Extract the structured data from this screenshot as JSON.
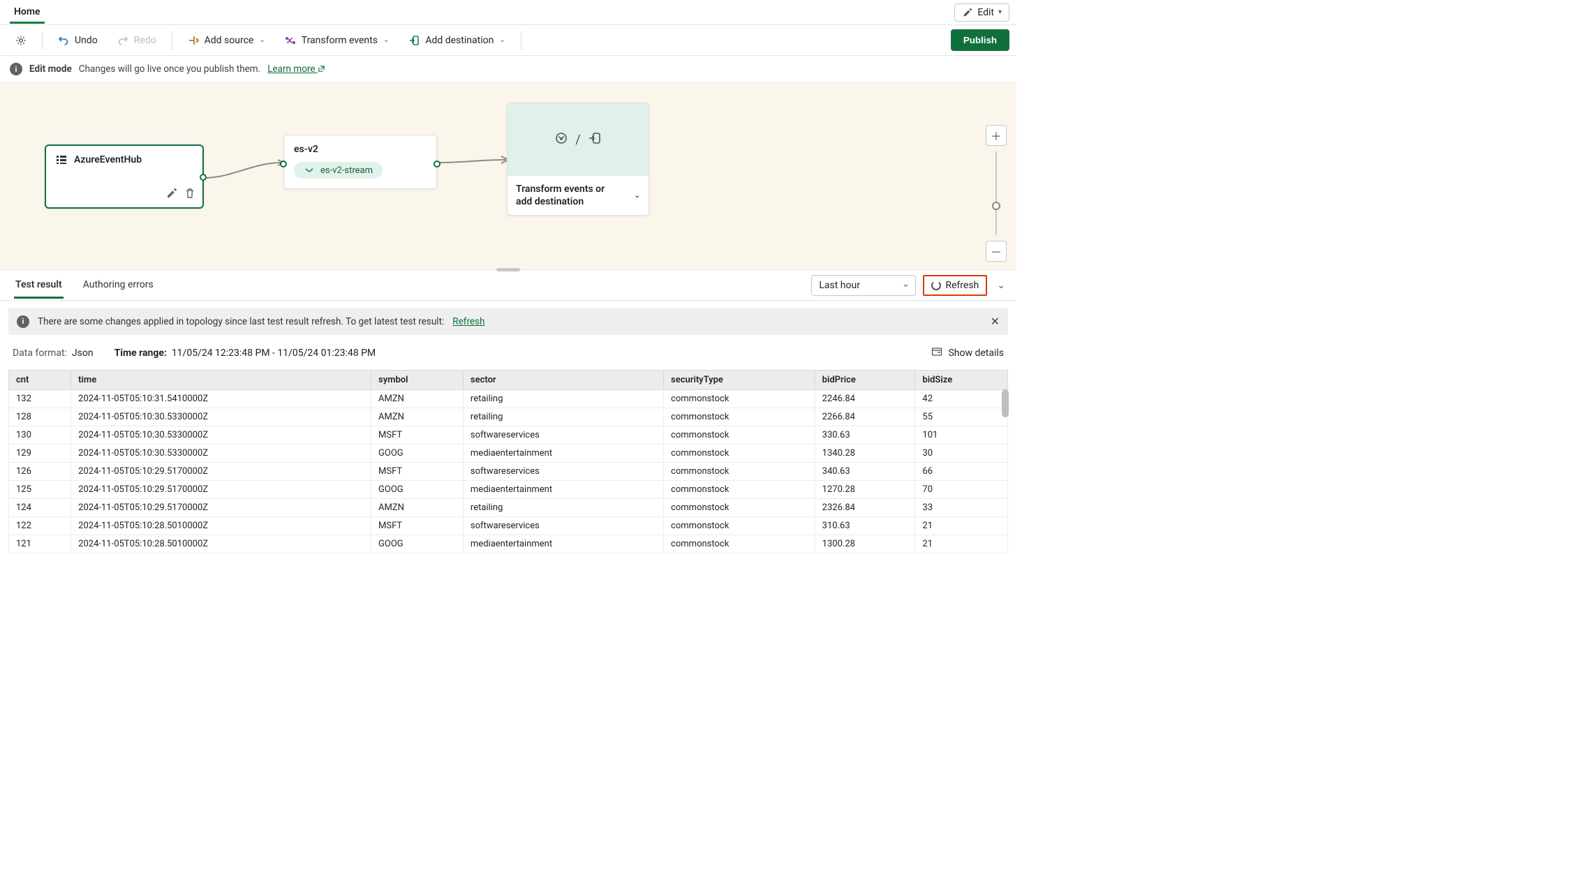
{
  "header": {
    "home": "Home",
    "edit": "Edit"
  },
  "toolbar": {
    "undo": "Undo",
    "redo": "Redo",
    "addSource": "Add source",
    "transform": "Transform events",
    "addDest": "Add destination",
    "publish": "Publish"
  },
  "editBanner": {
    "title": "Edit mode",
    "msg": "Changes will go live once you publish them.",
    "learn": "Learn more"
  },
  "canvas": {
    "source": "AzureEventHub",
    "stream": {
      "name": "es-v2",
      "chip": "es-v2-stream"
    },
    "target": {
      "title": "Transform events or add destination",
      "sep": "/"
    }
  },
  "results": {
    "tabs": {
      "test": "Test result",
      "errors": "Authoring errors"
    },
    "timeRange": "Last hour",
    "refresh": "Refresh",
    "warn": "There are some changes applied in topology since last test result refresh. To get latest test result:",
    "warnLink": "Refresh",
    "dataFormatLabel": "Data format:",
    "dataFormat": "Json",
    "timeRangeLabel": "Time range:",
    "timeRangeVal": "11/05/24 12:23:48 PM - 11/05/24 01:23:48 PM",
    "showDetails": "Show details",
    "columns": [
      "cnt",
      "time",
      "symbol",
      "sector",
      "securityType",
      "bidPrice",
      "bidSize"
    ],
    "rows": [
      [
        "132",
        "2024-11-05T05:10:31.5410000Z",
        "AMZN",
        "retailing",
        "commonstock",
        "2246.84",
        "42"
      ],
      [
        "128",
        "2024-11-05T05:10:30.5330000Z",
        "AMZN",
        "retailing",
        "commonstock",
        "2266.84",
        "55"
      ],
      [
        "130",
        "2024-11-05T05:10:30.5330000Z",
        "MSFT",
        "softwareservices",
        "commonstock",
        "330.63",
        "101"
      ],
      [
        "129",
        "2024-11-05T05:10:30.5330000Z",
        "GOOG",
        "mediaentertainment",
        "commonstock",
        "1340.28",
        "30"
      ],
      [
        "126",
        "2024-11-05T05:10:29.5170000Z",
        "MSFT",
        "softwareservices",
        "commonstock",
        "340.63",
        "66"
      ],
      [
        "125",
        "2024-11-05T05:10:29.5170000Z",
        "GOOG",
        "mediaentertainment",
        "commonstock",
        "1270.28",
        "70"
      ],
      [
        "124",
        "2024-11-05T05:10:29.5170000Z",
        "AMZN",
        "retailing",
        "commonstock",
        "2326.84",
        "33"
      ],
      [
        "122",
        "2024-11-05T05:10:28.5010000Z",
        "MSFT",
        "softwareservices",
        "commonstock",
        "310.63",
        "21"
      ],
      [
        "121",
        "2024-11-05T05:10:28.5010000Z",
        "GOOG",
        "mediaentertainment",
        "commonstock",
        "1300.28",
        "21"
      ]
    ]
  }
}
